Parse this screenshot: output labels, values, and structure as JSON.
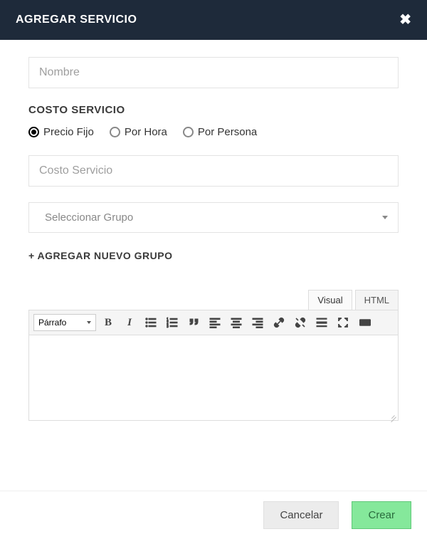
{
  "modal": {
    "title": "AGREGAR SERVICIO",
    "close_glyph": "✖"
  },
  "fields": {
    "name_placeholder": "Nombre",
    "cost_section_label": "COSTO SERVICIO",
    "cost_placeholder": "Costo Servicio",
    "group_placeholder": "Seleccionar Grupo",
    "add_group_label": "+ AGREGAR NUEVO GRUPO"
  },
  "radios": {
    "fixed": "Precio Fijo",
    "hourly": "Por Hora",
    "person": "Por Persona",
    "selected": "fixed"
  },
  "editor": {
    "tabs": {
      "visual": "Visual",
      "html": "HTML"
    },
    "active_tab": "visual",
    "format_label": "Párrafo",
    "icons": {
      "bold": "B",
      "italic": "I",
      "ul": "bulleted-list",
      "ol": "numbered-list",
      "quote": "blockquote",
      "align_left": "align-left",
      "align_center": "align-center",
      "align_right": "align-right",
      "link": "link",
      "unlink": "unlink",
      "hr": "horizontal-rule",
      "fullscreen": "fullscreen",
      "keyboard": "keyboard"
    }
  },
  "footer": {
    "cancel": "Cancelar",
    "create": "Crear"
  }
}
